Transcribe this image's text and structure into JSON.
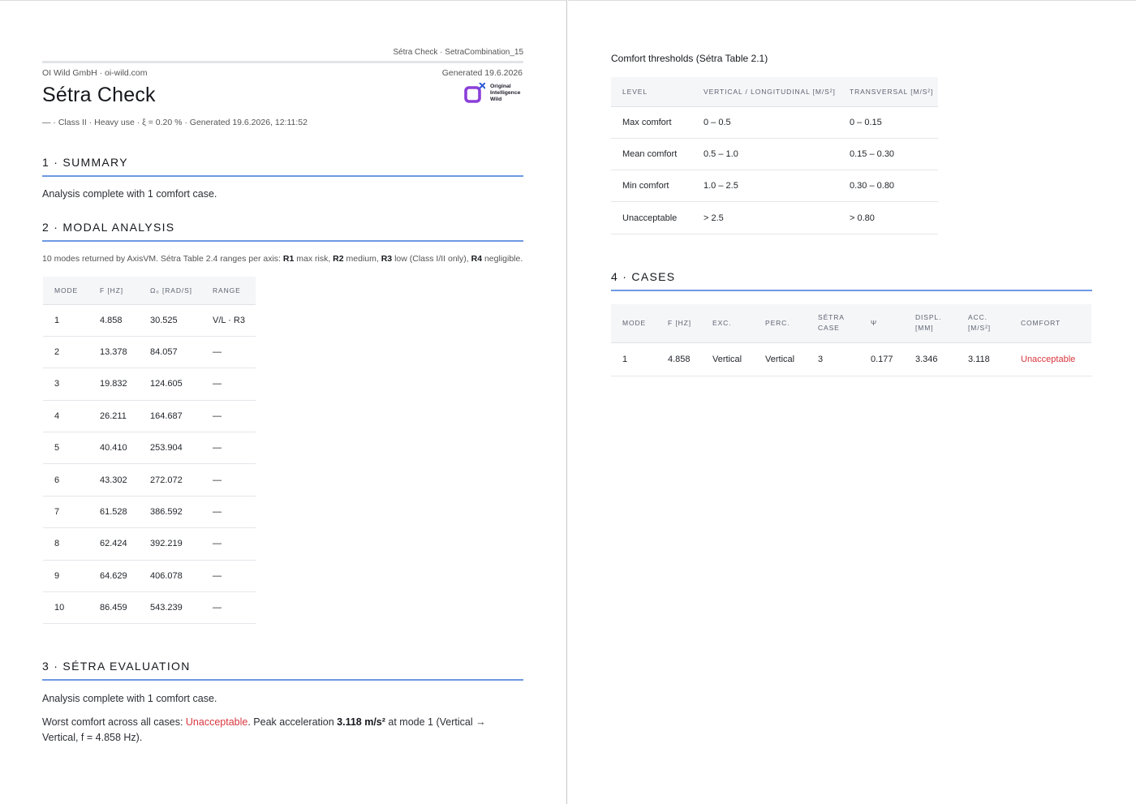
{
  "header": {
    "running_head": "Sétra Check · SetraCombination_15",
    "org_line": "OI Wild GmbH · oi-wild.com",
    "generated_date": "Generated 19.6.2026",
    "title": "Sétra Check",
    "meta_line": "— · Class II · Heavy use · ξ = 0.20 % · Generated 19.6.2026, 12:11:52",
    "logo": {
      "icon": "oi-wild-logo-icon",
      "lines": [
        "Original",
        "Intelligence",
        "Wild"
      ],
      "colors": {
        "mark": "#8b3fd9",
        "accent": "#2f5bd8"
      }
    }
  },
  "summary": {
    "heading": "1 · SUMMARY",
    "text": "Analysis complete with 1 comfort case."
  },
  "modal": {
    "heading": "2 · MODAL ANALYSIS",
    "caption_parts": [
      "10 modes returned by AxisVM. Sétra Table 2.4 ranges per axis: ",
      "R1",
      " max risk, ",
      "R2",
      " medium, ",
      "R3",
      " low (Class I/II only), ",
      "R4",
      " negligible."
    ],
    "columns": [
      "MODE",
      "F [HZ]",
      "Ω₀ [RAD/S]",
      "RANGE"
    ],
    "rows": [
      [
        "1",
        "4.858",
        "30.525",
        "V/L · R3"
      ],
      [
        "2",
        "13.378",
        "84.057",
        "—"
      ],
      [
        "3",
        "19.832",
        "124.605",
        "—"
      ],
      [
        "4",
        "26.211",
        "164.687",
        "—"
      ],
      [
        "5",
        "40.410",
        "253.904",
        "—"
      ],
      [
        "6",
        "43.302",
        "272.072",
        "—"
      ],
      [
        "7",
        "61.528",
        "386.592",
        "—"
      ],
      [
        "8",
        "62.424",
        "392.219",
        "—"
      ],
      [
        "9",
        "64.629",
        "406.078",
        "—"
      ],
      [
        "10",
        "86.459",
        "543.239",
        "—"
      ]
    ]
  },
  "evaluation": {
    "heading": "3 · SÉTRA EVALUATION",
    "text": "Analysis complete with 1 comfort case.",
    "worst_prefix": "Worst comfort across all cases: ",
    "worst_status": "Unacceptable",
    "worst_mid": ". Peak acceleration ",
    "peak_value": "3.118 m/s²",
    "worst_suffix": " at mode 1 (Vertical → Vertical, f = 4.858 Hz)."
  },
  "thresholds": {
    "heading": "Comfort thresholds (Sétra Table 2.1)",
    "columns": [
      "LEVEL",
      "VERTICAL / LONGITUDINAL [M/S²]",
      "TRANSVERSAL [M/S²]"
    ],
    "rows": [
      [
        "Max comfort",
        "0 – 0.5",
        "0 – 0.15"
      ],
      [
        "Mean comfort",
        "0.5 – 1.0",
        "0.15 – 0.30"
      ],
      [
        "Min comfort",
        "1.0 – 2.5",
        "0.30 – 0.80"
      ],
      [
        "Unacceptable",
        "> 2.5",
        "> 0.80"
      ]
    ]
  },
  "cases": {
    "heading": "4 · CASES",
    "columns": [
      [
        "MODE"
      ],
      [
        "F [HZ]"
      ],
      [
        "EXC."
      ],
      [
        "PERC."
      ],
      [
        "SÉTRA",
        "CASE"
      ],
      [
        "Ψ"
      ],
      [
        "DISPL.",
        "[MM]"
      ],
      [
        "ACC.",
        "[M/S²]"
      ],
      [
        "COMFORT"
      ]
    ],
    "rows": [
      [
        "1",
        "4.858",
        "Vertical",
        "Vertical",
        "3",
        "0.177",
        "3.346",
        "3.118",
        "Unacceptable"
      ]
    ],
    "status_color": "#d9363e"
  },
  "colors": {
    "section_rule": "#6e98e3",
    "table_header_bg": "#f5f6f8",
    "danger": "#d9363e"
  }
}
